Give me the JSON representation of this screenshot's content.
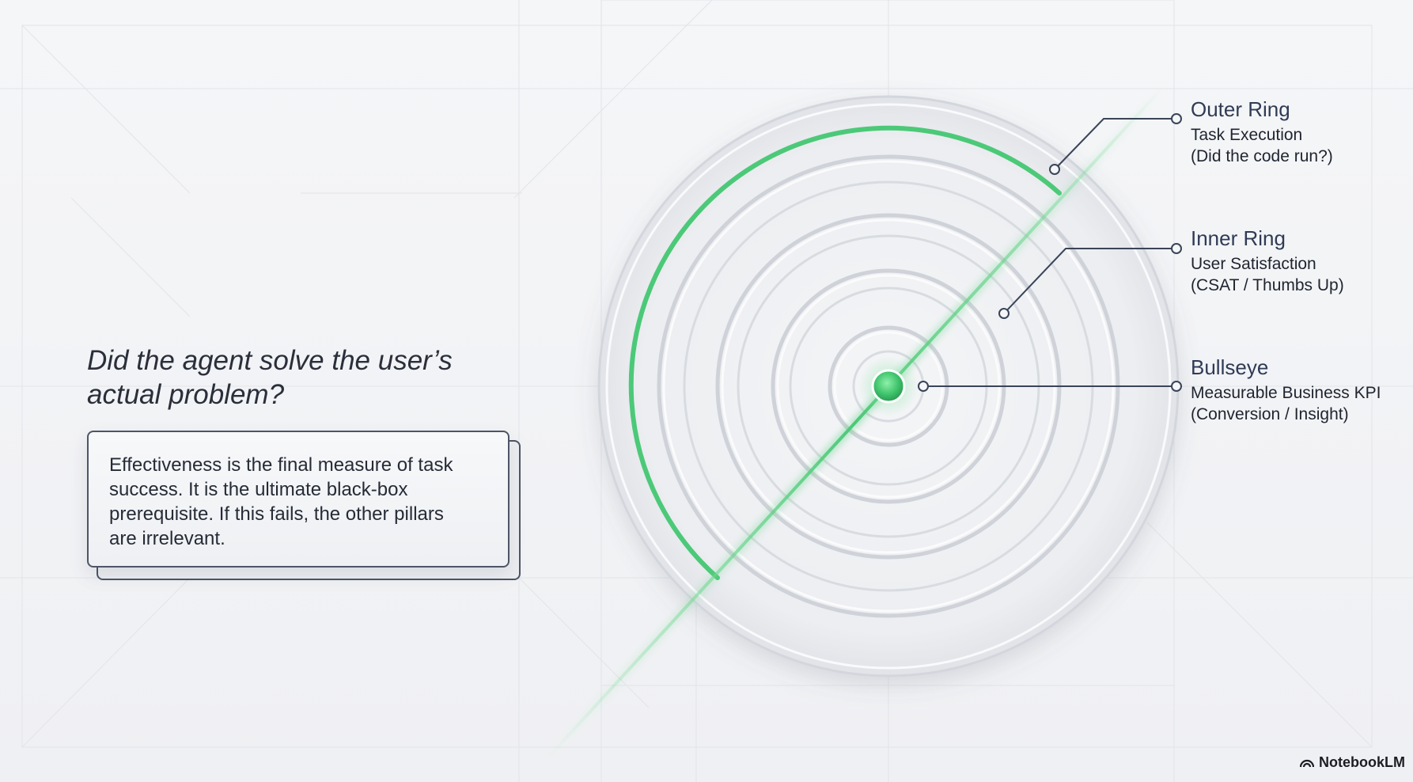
{
  "question": {
    "line1": "Did the agent solve the user’s",
    "line2": "actual problem?"
  },
  "card": {
    "line1": "Effectiveness is the final measure of task",
    "line2": "success. It is the ultimate black-box",
    "line3": "prerequisite. If this fails, the other pillars",
    "line4": "are irrelevant."
  },
  "labels": {
    "outer_ring": {
      "title": "Outer Ring",
      "line1": "Task Execution",
      "line2": "(Did the code run?)"
    },
    "inner_ring": {
      "title": "Inner Ring",
      "line1": "User Satisfaction",
      "line2": "(CSAT / Thumbs Up)"
    },
    "bullseye": {
      "title": "Bullseye",
      "line1": "Measurable Business KPI",
      "line2": "(Conversion / Insight)"
    }
  },
  "brand": {
    "name": "NotebookLM"
  },
  "colors": {
    "accent_green": "#4cc978",
    "ring_stroke": "#c9ccd3",
    "leader_line": "#3a4458",
    "text_dark": "#262b36"
  },
  "icons": {
    "brand": "notebooklm-logo-icon"
  }
}
